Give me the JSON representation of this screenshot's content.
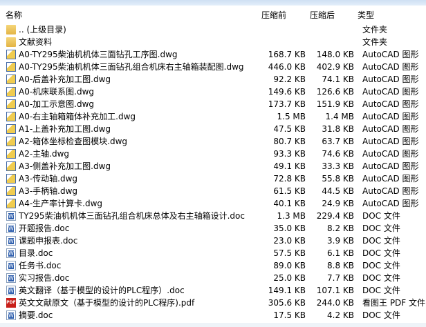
{
  "header": {
    "name": "名称",
    "before": "压缩前",
    "after": "压缩后",
    "type": "类型"
  },
  "files": [
    {
      "icon": "folder",
      "name": ".. (上级目录)",
      "before": "",
      "after": "",
      "type": "文件夹"
    },
    {
      "icon": "folder",
      "name": "文献资料",
      "before": "",
      "after": "",
      "type": "文件夹"
    },
    {
      "icon": "dwg",
      "name": "A0-TY295柴油机机体三面钻孔工序图.dwg",
      "before": "168.7 KB",
      "after": "148.0 KB",
      "type": "AutoCAD 图形"
    },
    {
      "icon": "dwg",
      "name": "A0-TY295柴油机机体三面钻孔组合机床右主轴箱装配图.dwg",
      "before": "446.0 KB",
      "after": "402.9 KB",
      "type": "AutoCAD 图形"
    },
    {
      "icon": "dwg",
      "name": "A0-后盖补充加工图.dwg",
      "before": "92.2 KB",
      "after": "74.1 KB",
      "type": "AutoCAD 图形"
    },
    {
      "icon": "dwg",
      "name": "A0-机床联系图.dwg",
      "before": "149.6 KB",
      "after": "126.6 KB",
      "type": "AutoCAD 图形"
    },
    {
      "icon": "dwg",
      "name": "A0-加工示意图.dwg",
      "before": "173.7 KB",
      "after": "151.9 KB",
      "type": "AutoCAD 图形"
    },
    {
      "icon": "dwg",
      "name": "A0-右主轴箱箱体补充加工.dwg",
      "before": "1.5 MB",
      "after": "1.4 MB",
      "type": "AutoCAD 图形"
    },
    {
      "icon": "dwg",
      "name": "A1-上盖补充加工图.dwg",
      "before": "47.5 KB",
      "after": "31.8 KB",
      "type": "AutoCAD 图形"
    },
    {
      "icon": "dwg",
      "name": "A2-箱体坐标检查图模块.dwg",
      "before": "80.7 KB",
      "after": "63.7 KB",
      "type": "AutoCAD 图形"
    },
    {
      "icon": "dwg",
      "name": "A2-主轴.dwg",
      "before": "93.3 KB",
      "after": "74.6 KB",
      "type": "AutoCAD 图形"
    },
    {
      "icon": "dwg",
      "name": "A3-侧盖补充加工图.dwg",
      "before": "49.1 KB",
      "after": "33.3 KB",
      "type": "AutoCAD 图形"
    },
    {
      "icon": "dwg",
      "name": "A3-传动轴.dwg",
      "before": "72.8 KB",
      "after": "55.8 KB",
      "type": "AutoCAD 图形"
    },
    {
      "icon": "dwg",
      "name": "A3-手柄轴.dwg",
      "before": "61.5 KB",
      "after": "44.5 KB",
      "type": "AutoCAD 图形"
    },
    {
      "icon": "dwg",
      "name": "A4-生产率计算卡.dwg",
      "before": "40.1 KB",
      "after": "24.9 KB",
      "type": "AutoCAD 图形"
    },
    {
      "icon": "doc",
      "name": "TY295柴油机机体三面钻孔组合机床总体及右主轴箱设计.doc",
      "before": "1.3 MB",
      "after": "229.4 KB",
      "type": "DOC 文件"
    },
    {
      "icon": "doc",
      "name": "开题报告.doc",
      "before": "35.0 KB",
      "after": "8.2 KB",
      "type": "DOC 文件"
    },
    {
      "icon": "doc",
      "name": "课题申报表.doc",
      "before": "23.0 KB",
      "after": "3.9 KB",
      "type": "DOC 文件"
    },
    {
      "icon": "doc",
      "name": "目录.doc",
      "before": "57.5 KB",
      "after": "6.1 KB",
      "type": "DOC 文件"
    },
    {
      "icon": "doc",
      "name": "任务书.doc",
      "before": "89.0 KB",
      "after": "8.8 KB",
      "type": "DOC 文件"
    },
    {
      "icon": "doc",
      "name": "实习报告.doc",
      "before": "25.0 KB",
      "after": "7.7 KB",
      "type": "DOC 文件"
    },
    {
      "icon": "doc",
      "name": "英文翻译（基于模型的设计的PLC程序）.doc",
      "before": "149.1 KB",
      "after": "107.1 KB",
      "type": "DOC 文件"
    },
    {
      "icon": "pdf",
      "name": "英文文献原文（基于模型的设计的PLC程序).pdf",
      "before": "305.6 KB",
      "after": "244.0 KB",
      "type": "看图王 PDF 文件"
    },
    {
      "icon": "doc",
      "name": "摘要.doc",
      "before": "17.5 KB",
      "after": "4.2 KB",
      "type": "DOC 文件"
    }
  ]
}
